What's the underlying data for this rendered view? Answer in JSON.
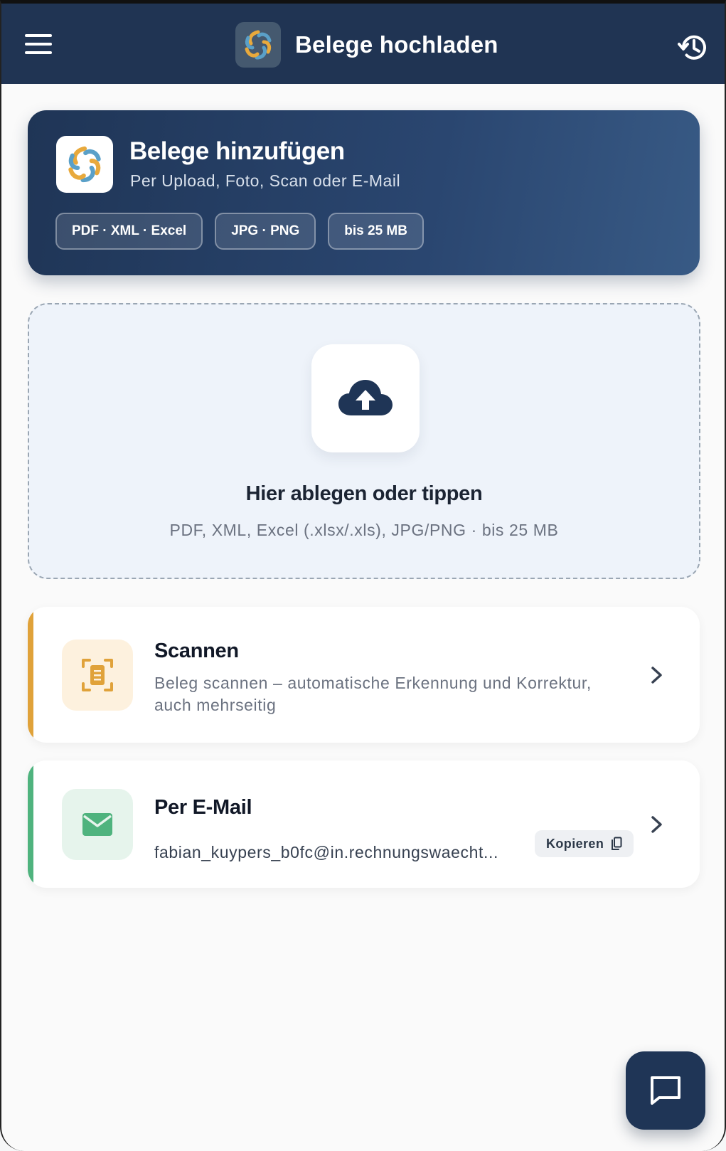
{
  "header": {
    "title": "Belege hochladen",
    "menu_icon": "menu-icon",
    "history_icon": "history-icon"
  },
  "hero": {
    "title": "Belege hinzufügen",
    "subtitle": "Per Upload, Foto, Scan oder E-Mail",
    "chips": [
      "PDF · XML · Excel",
      "JPG · PNG",
      "bis 25 MB"
    ]
  },
  "dropzone": {
    "title": "Hier ablegen oder tippen",
    "subtitle": "PDF, XML, Excel (.xlsx/.xls), JPG/PNG · bis 25 MB",
    "icon": "cloud-upload-icon"
  },
  "scan": {
    "title": "Scannen",
    "description": "Beleg scannen – automatische Erkennung und Korrektur, auch mehrseitig",
    "accent": "#e0a23a"
  },
  "email": {
    "title": "Per E-Mail",
    "address": "fabian_kuypers_b0fc@in.rechnungswaecht...",
    "copy_label": "Kopieren",
    "accent": "#4fb37e"
  },
  "colors": {
    "primary": "#203453",
    "scan_bg": "#fdf1de",
    "email_bg": "#e6f4ec"
  }
}
